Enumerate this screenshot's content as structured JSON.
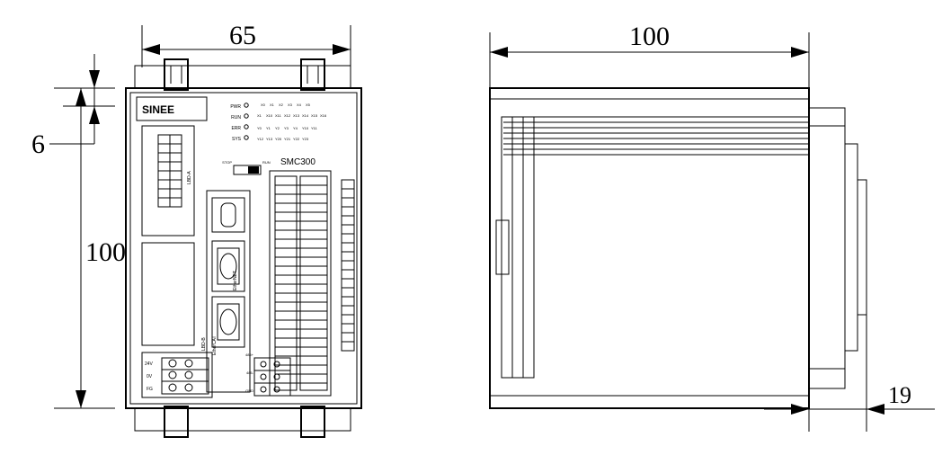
{
  "diagram": {
    "brand": "SINEE",
    "model": "SMC300",
    "dims": {
      "width_front": "65",
      "height_front": "100",
      "top_offset": "6",
      "depth_side": "100",
      "depth_tab": "19"
    },
    "status_leds": [
      "PWR",
      "RUN",
      "ERR",
      "SYS"
    ],
    "io_rows": [
      [
        "X0",
        "X1",
        "X2",
        "X3",
        "X4",
        "X5"
      ],
      [
        "X1",
        "X10",
        "X11",
        "X12",
        "X13",
        "X14",
        "X15",
        "X16"
      ],
      [
        "Y0",
        "Y1",
        "Y2",
        "Y3",
        "Y4",
        "Y10",
        "Y11"
      ],
      [
        "Y12",
        "Y13",
        "Y20",
        "Y21",
        "Y22",
        "Y23"
      ]
    ],
    "switch": {
      "left": "STOP",
      "right": "RUN"
    },
    "ports": {
      "lbd_a": "LBD-A",
      "lbd_b": "LBD-B",
      "ethercat": "EtherCAT",
      "ethernet": "EtherNET"
    },
    "power_terms": [
      "24V",
      "0V",
      "FG"
    ],
    "rs485_terms": [
      "485+",
      "485-",
      "GND"
    ]
  }
}
